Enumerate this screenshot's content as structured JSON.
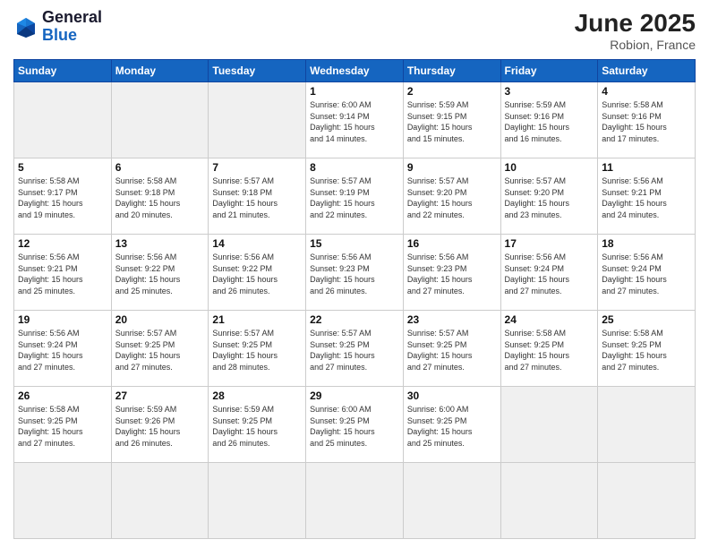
{
  "header": {
    "logo_line1": "General",
    "logo_line2": "Blue",
    "month": "June 2025",
    "location": "Robion, France"
  },
  "weekdays": [
    "Sunday",
    "Monday",
    "Tuesday",
    "Wednesday",
    "Thursday",
    "Friday",
    "Saturday"
  ],
  "days": [
    {
      "num": "",
      "info": ""
    },
    {
      "num": "",
      "info": ""
    },
    {
      "num": "",
      "info": ""
    },
    {
      "num": "1",
      "info": "Sunrise: 6:00 AM\nSunset: 9:14 PM\nDaylight: 15 hours\nand 14 minutes."
    },
    {
      "num": "2",
      "info": "Sunrise: 5:59 AM\nSunset: 9:15 PM\nDaylight: 15 hours\nand 15 minutes."
    },
    {
      "num": "3",
      "info": "Sunrise: 5:59 AM\nSunset: 9:16 PM\nDaylight: 15 hours\nand 16 minutes."
    },
    {
      "num": "4",
      "info": "Sunrise: 5:58 AM\nSunset: 9:16 PM\nDaylight: 15 hours\nand 17 minutes."
    },
    {
      "num": "5",
      "info": "Sunrise: 5:58 AM\nSunset: 9:17 PM\nDaylight: 15 hours\nand 19 minutes."
    },
    {
      "num": "6",
      "info": "Sunrise: 5:58 AM\nSunset: 9:18 PM\nDaylight: 15 hours\nand 20 minutes."
    },
    {
      "num": "7",
      "info": "Sunrise: 5:57 AM\nSunset: 9:18 PM\nDaylight: 15 hours\nand 21 minutes."
    },
    {
      "num": "8",
      "info": "Sunrise: 5:57 AM\nSunset: 9:19 PM\nDaylight: 15 hours\nand 22 minutes."
    },
    {
      "num": "9",
      "info": "Sunrise: 5:57 AM\nSunset: 9:20 PM\nDaylight: 15 hours\nand 22 minutes."
    },
    {
      "num": "10",
      "info": "Sunrise: 5:57 AM\nSunset: 9:20 PM\nDaylight: 15 hours\nand 23 minutes."
    },
    {
      "num": "11",
      "info": "Sunrise: 5:56 AM\nSunset: 9:21 PM\nDaylight: 15 hours\nand 24 minutes."
    },
    {
      "num": "12",
      "info": "Sunrise: 5:56 AM\nSunset: 9:21 PM\nDaylight: 15 hours\nand 25 minutes."
    },
    {
      "num": "13",
      "info": "Sunrise: 5:56 AM\nSunset: 9:22 PM\nDaylight: 15 hours\nand 25 minutes."
    },
    {
      "num": "14",
      "info": "Sunrise: 5:56 AM\nSunset: 9:22 PM\nDaylight: 15 hours\nand 26 minutes."
    },
    {
      "num": "15",
      "info": "Sunrise: 5:56 AM\nSunset: 9:23 PM\nDaylight: 15 hours\nand 26 minutes."
    },
    {
      "num": "16",
      "info": "Sunrise: 5:56 AM\nSunset: 9:23 PM\nDaylight: 15 hours\nand 27 minutes."
    },
    {
      "num": "17",
      "info": "Sunrise: 5:56 AM\nSunset: 9:24 PM\nDaylight: 15 hours\nand 27 minutes."
    },
    {
      "num": "18",
      "info": "Sunrise: 5:56 AM\nSunset: 9:24 PM\nDaylight: 15 hours\nand 27 minutes."
    },
    {
      "num": "19",
      "info": "Sunrise: 5:56 AM\nSunset: 9:24 PM\nDaylight: 15 hours\nand 27 minutes."
    },
    {
      "num": "20",
      "info": "Sunrise: 5:57 AM\nSunset: 9:25 PM\nDaylight: 15 hours\nand 27 minutes."
    },
    {
      "num": "21",
      "info": "Sunrise: 5:57 AM\nSunset: 9:25 PM\nDaylight: 15 hours\nand 28 minutes."
    },
    {
      "num": "22",
      "info": "Sunrise: 5:57 AM\nSunset: 9:25 PM\nDaylight: 15 hours\nand 27 minutes."
    },
    {
      "num": "23",
      "info": "Sunrise: 5:57 AM\nSunset: 9:25 PM\nDaylight: 15 hours\nand 27 minutes."
    },
    {
      "num": "24",
      "info": "Sunrise: 5:58 AM\nSunset: 9:25 PM\nDaylight: 15 hours\nand 27 minutes."
    },
    {
      "num": "25",
      "info": "Sunrise: 5:58 AM\nSunset: 9:25 PM\nDaylight: 15 hours\nand 27 minutes."
    },
    {
      "num": "26",
      "info": "Sunrise: 5:58 AM\nSunset: 9:25 PM\nDaylight: 15 hours\nand 27 minutes."
    },
    {
      "num": "27",
      "info": "Sunrise: 5:59 AM\nSunset: 9:26 PM\nDaylight: 15 hours\nand 26 minutes."
    },
    {
      "num": "28",
      "info": "Sunrise: 5:59 AM\nSunset: 9:25 PM\nDaylight: 15 hours\nand 26 minutes."
    },
    {
      "num": "29",
      "info": "Sunrise: 6:00 AM\nSunset: 9:25 PM\nDaylight: 15 hours\nand 25 minutes."
    },
    {
      "num": "30",
      "info": "Sunrise: 6:00 AM\nSunset: 9:25 PM\nDaylight: 15 hours\nand 25 minutes."
    },
    {
      "num": "",
      "info": ""
    },
    {
      "num": "",
      "info": ""
    },
    {
      "num": "",
      "info": ""
    },
    {
      "num": "",
      "info": ""
    },
    {
      "num": "",
      "info": ""
    }
  ]
}
